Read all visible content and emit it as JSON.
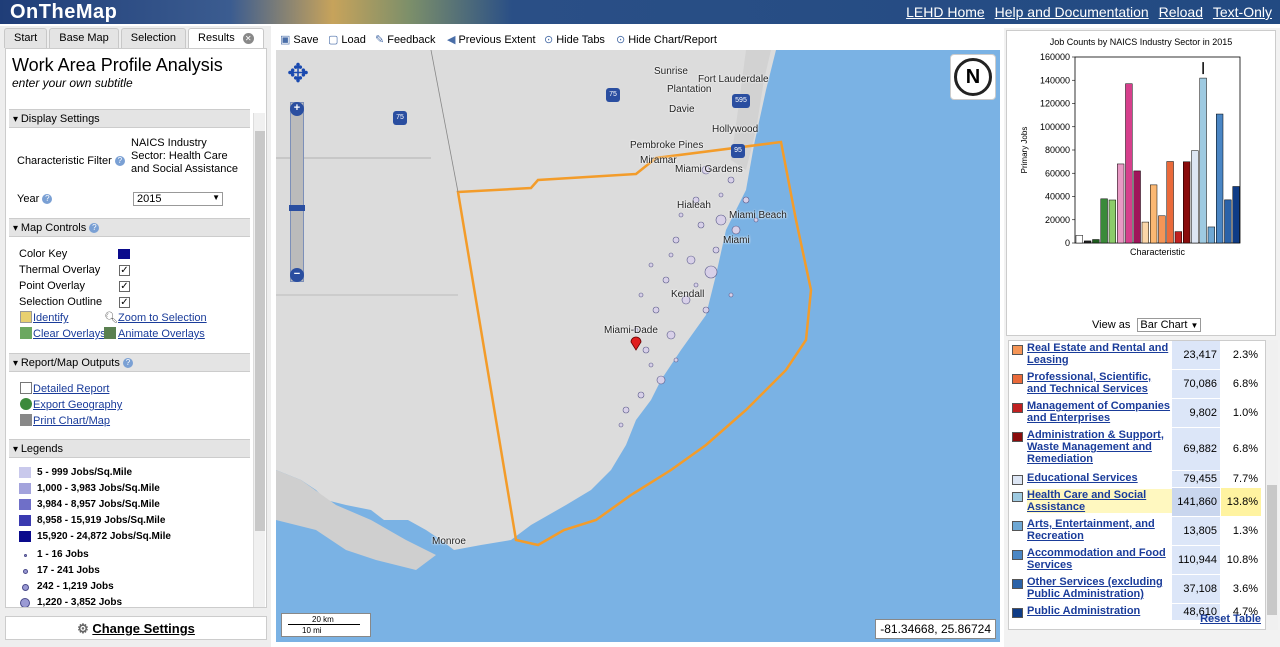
{
  "header": {
    "app_title": "OnTheMap",
    "links": [
      "LEHD Home",
      "Help and Documentation",
      "Reload",
      "Text-Only"
    ]
  },
  "tabs": [
    "Start",
    "Base Map",
    "Selection",
    "Results"
  ],
  "panel": {
    "title": "Work Area Profile Analysis",
    "subtitle": "enter your own subtitle",
    "display_settings": "Display Settings",
    "characteristic_filter_label": "Characteristic Filter",
    "characteristic_filter_value": "NAICS Industry Sector: Health Care and Social Assistance",
    "year_label": "Year",
    "year_value": "2015",
    "map_controls": "Map Controls",
    "controls": {
      "color_key": "Color Key",
      "thermal": "Thermal Overlay",
      "point": "Point Overlay",
      "selection": "Selection Outline"
    },
    "check": "✓",
    "tools": {
      "identify": "Identify",
      "zoom": "Zoom to Selection",
      "clear": "Clear Overlays",
      "animate": "Animate Overlays"
    },
    "outputs": "Report/Map Outputs",
    "out_links": {
      "report": "Detailed Report",
      "export": "Export Geography",
      "print": "Print Chart/Map"
    },
    "legends": "Legends",
    "density": [
      {
        "label": "5 - 999  Jobs/Sq.Mile",
        "color": "#c9c9ec"
      },
      {
        "label": "1,000 - 3,983  Jobs/Sq.Mile",
        "color": "#a3a3dc"
      },
      {
        "label": "3,984 - 8,957  Jobs/Sq.Mile",
        "color": "#6f6fc8"
      },
      {
        "label": "8,958 - 15,919  Jobs/Sq.Mile",
        "color": "#3a3ab0"
      },
      {
        "label": "15,920 - 24,872  Jobs/Sq.Mile",
        "color": "#0a0a8c"
      }
    ],
    "points": [
      "1 - 16 Jobs",
      "17 - 241 Jobs",
      "242 - 1,219 Jobs",
      "1,220 - 3,852 Jobs"
    ],
    "change_settings": "Change Settings"
  },
  "toolbar": {
    "save": "Save",
    "load": "Load",
    "feedback": "Feedback",
    "prev": "Previous Extent",
    "hide_tabs": "Hide Tabs",
    "hide_chart": "Hide Chart/Report"
  },
  "map": {
    "places": [
      "Sunrise",
      "Fort Lauderdale",
      "Plantation",
      "Davie",
      "Hollywood",
      "Pembroke Pines",
      "Miramar",
      "Miami Gardens",
      "Hialeah",
      "Miami Beach",
      "Miami",
      "Kendall",
      "Miami-Dade",
      "Monroe"
    ],
    "shields": [
      "75",
      "75",
      "595",
      "95"
    ],
    "scale_km": "20 km",
    "scale_mi": "10 mi",
    "coords": "-81.34668, 25.86724",
    "north": "N",
    "zoom_plus": "+",
    "zoom_minus": "−"
  },
  "chart_data": {
    "type": "bar",
    "title": "Job Counts by NAICS Industry Sector in 2015",
    "xlabel": "Characteristic",
    "ylabel": "Primary Jobs",
    "ylim": [
      0,
      160000
    ],
    "yticks": [
      "0",
      "20000",
      "40000",
      "60000",
      "80000",
      "100000",
      "120000",
      "140000",
      "160000"
    ],
    "values": [
      6500,
      1800,
      3000,
      38000,
      37000,
      68000,
      137000,
      62000,
      18000,
      50000,
      23417,
      70086,
      9802,
      69882,
      79455,
      141860,
      13805,
      110944,
      37108,
      48610
    ],
    "colors": [
      "#ffffff",
      "#222222",
      "#1d5c1d",
      "#3a8a3a",
      "#8ccc6a",
      "#e899c4",
      "#d63f8c",
      "#a0145a",
      "#fbd6a8",
      "#fbb873",
      "#f59556",
      "#ea6a3a",
      "#c02020",
      "#8a0c0c",
      "#dde6f4",
      "#9ecae1",
      "#6fa8d4",
      "#4a86c4",
      "#2a62a8",
      "#0f3c86"
    ],
    "highlight_index": 15
  },
  "view_as": {
    "label": "View as",
    "value": "Bar Chart"
  },
  "table": {
    "rows": [
      {
        "name": "Real Estate and Rental and Leasing",
        "count": "23,417",
        "pct": "2.3%",
        "color": "#f59556"
      },
      {
        "name": "Professional, Scientific, and Technical Services",
        "count": "70,086",
        "pct": "6.8%",
        "color": "#ea6a3a"
      },
      {
        "name": "Management of Companies and Enterprises",
        "count": "9,802",
        "pct": "1.0%",
        "color": "#c02020"
      },
      {
        "name": "Administration & Support, Waste Management and Remediation",
        "count": "69,882",
        "pct": "6.8%",
        "color": "#8a0c0c"
      },
      {
        "name": "Educational Services",
        "count": "79,455",
        "pct": "7.7%",
        "color": "#dde6f4"
      },
      {
        "name": "Health Care and Social Assistance",
        "count": "141,860",
        "pct": "13.8%",
        "color": "#9ecae1"
      },
      {
        "name": "Arts, Entertainment, and Recreation",
        "count": "13,805",
        "pct": "1.3%",
        "color": "#6fa8d4"
      },
      {
        "name": "Accommodation and Food Services",
        "count": "110,944",
        "pct": "10.8%",
        "color": "#4a86c4"
      },
      {
        "name": "Other Services (excluding Public Administration)",
        "count": "37,108",
        "pct": "3.6%",
        "color": "#2a62a8"
      },
      {
        "name": "Public Administration",
        "count": "48,610",
        "pct": "4.7%",
        "color": "#0f3c86"
      }
    ],
    "reset": "Reset Table"
  }
}
